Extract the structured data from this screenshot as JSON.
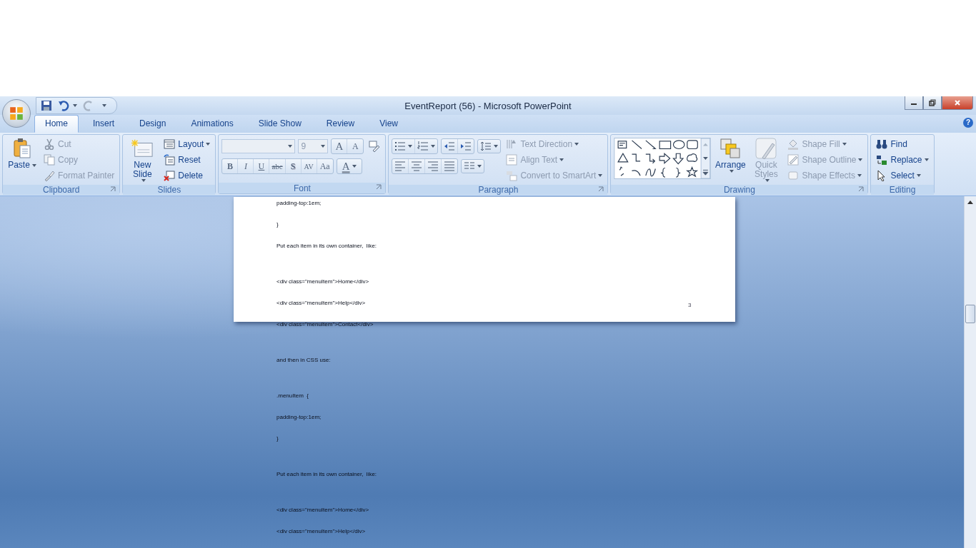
{
  "window": {
    "title": "EventReport (56) - Microsoft PowerPoint"
  },
  "help": "?",
  "tabs": [
    {
      "label": "Home",
      "selected": true
    },
    {
      "label": "Insert",
      "selected": false
    },
    {
      "label": "Design",
      "selected": false
    },
    {
      "label": "Animations",
      "selected": false
    },
    {
      "label": "Slide Show",
      "selected": false
    },
    {
      "label": "Review",
      "selected": false
    },
    {
      "label": "View",
      "selected": false
    }
  ],
  "groups": [
    {
      "kind": "buttons",
      "label": "Clipboard",
      "launcher": true,
      "columns": [
        [
          {
            "label": "Paste",
            "kind": "large",
            "dropdown": true,
            "disabled": false
          }
        ],
        [
          {
            "label": "Cut",
            "kind": "small",
            "dropdown": false,
            "disabled": true
          },
          {
            "label": "Copy",
            "kind": "small",
            "dropdown": false,
            "disabled": true
          },
          {
            "label": "Format Painter",
            "kind": "small",
            "dropdown": false,
            "disabled": true
          }
        ]
      ]
    },
    {
      "kind": "buttons",
      "label": "Slides",
      "launcher": false,
      "columns": [
        [
          {
            "label": "New Slide",
            "kind": "large",
            "dropdown": true,
            "disabled": false
          }
        ],
        [
          {
            "label": "Layout",
            "kind": "small",
            "dropdown": true,
            "disabled": false
          },
          {
            "label": "Reset",
            "kind": "small",
            "dropdown": false,
            "disabled": false
          },
          {
            "label": "Delete",
            "kind": "small",
            "dropdown": false,
            "disabled": false
          }
        ]
      ]
    },
    {
      "kind": "font",
      "label": "Font",
      "launcher": true,
      "size_value": "9",
      "grow": "A",
      "shrink": "A",
      "styles": [
        "B",
        "I",
        "U",
        "abc",
        "S",
        "AV",
        "Aa"
      ],
      "color_button": "A"
    },
    {
      "kind": "paragraph",
      "label": "Paragraph",
      "launcher": true,
      "columns": [
        [
          {
            "label": "Text Direction",
            "kind": "small",
            "dropdown": true,
            "disabled": true
          },
          {
            "label": "Align Text",
            "kind": "small",
            "dropdown": true,
            "disabled": true
          },
          {
            "label": "Convert to SmartArt",
            "kind": "small",
            "dropdown": true,
            "disabled": true
          }
        ]
      ]
    },
    {
      "kind": "drawing",
      "label": "Drawing",
      "launcher": true,
      "columns": [
        [
          {
            "label": "Arrange",
            "kind": "large",
            "dropdown": true,
            "disabled": false
          }
        ],
        [
          {
            "label": "Quick Styles",
            "kind": "large",
            "dropdown": true,
            "disabled": true
          }
        ],
        [
          {
            "label": "Shape Fill",
            "kind": "small",
            "dropdown": true,
            "disabled": true
          },
          {
            "label": "Shape Outline",
            "kind": "small",
            "dropdown": true,
            "disabled": true
          },
          {
            "label": "Shape Effects",
            "kind": "small",
            "dropdown": true,
            "disabled": true
          }
        ]
      ]
    },
    {
      "kind": "buttons",
      "label": "Editing",
      "launcher": false,
      "columns": [
        [
          {
            "label": "Find",
            "kind": "small",
            "dropdown": false,
            "disabled": false
          },
          {
            "label": "Replace",
            "kind": "small",
            "dropdown": true,
            "disabled": false
          },
          {
            "label": "Select",
            "kind": "small",
            "dropdown": true,
            "disabled": false
          }
        ]
      ]
    }
  ],
  "slide": {
    "page_number": "3"
  },
  "paragraphs": [
    [
      "padding-top:1em;",
      "}",
      "Put each item in its own container,  like:"
    ],
    [
      "<div class=\"menuItem\">Home</div>",
      "<div class=\"menuItem\">Help</div>",
      "<div class=\"menuItem\">Contact</div>"
    ],
    [
      "and then in CSS use:"
    ],
    [
      ".menuItem  {",
      "padding-top:1em;",
      "}"
    ],
    [
      "Put each item in its own container,  like:"
    ],
    [
      "<div class=\"menuItem\">Home</div>",
      "<div class=\"menuItem\">Help</div>"
    ]
  ]
}
